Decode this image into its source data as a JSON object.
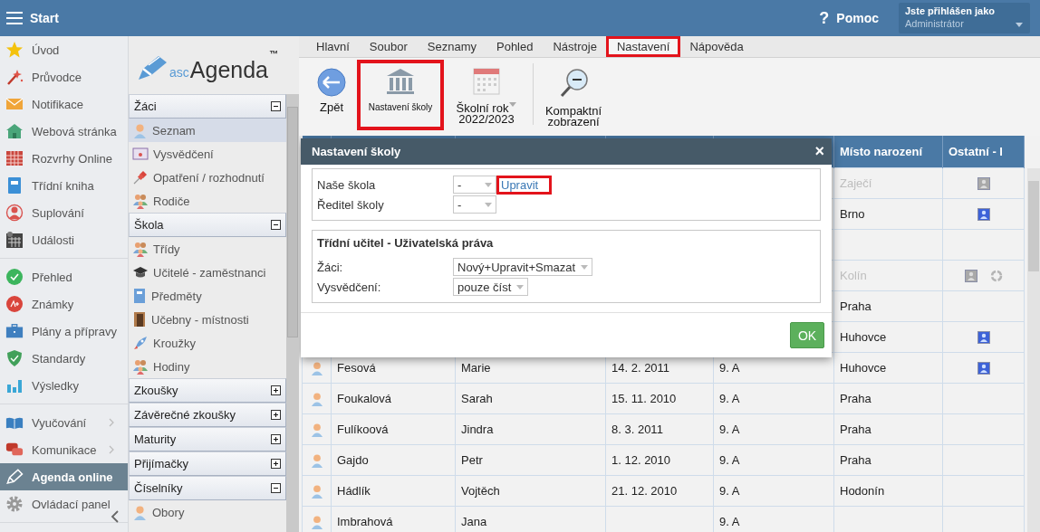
{
  "top_bar": {
    "title": "Start",
    "help_icon": "?",
    "help": "Pomoc",
    "user": {
      "caption": "Jste přihlášen jako",
      "role": "Administrátor"
    }
  },
  "nav": {
    "groups": [
      {
        "items": [
          {
            "label": "Úvod",
            "selected": false,
            "has_submenu": false
          },
          {
            "label": "Průvodce",
            "selected": false,
            "has_submenu": false
          },
          {
            "label": "Notifikace",
            "selected": false,
            "has_submenu": false
          },
          {
            "label": "Webová stránka",
            "selected": false,
            "has_submenu": false
          },
          {
            "label": "Rozvrhy Online",
            "selected": false,
            "has_submenu": false
          },
          {
            "label": "Třídní kniha",
            "selected": false,
            "has_submenu": false
          },
          {
            "label": "Suplování",
            "selected": false,
            "has_submenu": false
          },
          {
            "label": "Události",
            "selected": false,
            "has_submenu": false
          }
        ]
      },
      {
        "items": [
          {
            "label": "Přehled",
            "selected": false,
            "has_submenu": false
          },
          {
            "label": "Známky",
            "selected": false,
            "has_submenu": false
          },
          {
            "label": "Plány a přípravy",
            "selected": false,
            "has_submenu": false
          },
          {
            "label": "Standardy",
            "selected": false,
            "has_submenu": false
          },
          {
            "label": "Výsledky",
            "selected": false,
            "has_submenu": false
          }
        ]
      },
      {
        "items": [
          {
            "label": "Vyučování",
            "selected": false,
            "has_submenu": true
          },
          {
            "label": "Komunikace",
            "selected": false,
            "has_submenu": true
          },
          {
            "label": "Agenda online",
            "selected": true,
            "has_submenu": false
          },
          {
            "label": "Ovládací panel",
            "selected": false,
            "has_submenu": false
          }
        ]
      }
    ]
  },
  "agenda_sidebar": {
    "logo": {
      "prefix": "asc",
      "name": "Agenda",
      "mark": "™"
    },
    "sections": [
      {
        "title": "Žáci",
        "expanded": true,
        "items": [
          {
            "label": "Seznam",
            "selected": true
          },
          {
            "label": "Vysvědčení",
            "selected": false
          },
          {
            "label": "Opatření / rozhodnutí",
            "selected": false
          },
          {
            "label": "Rodiče",
            "selected": false
          }
        ]
      },
      {
        "title": "Škola",
        "expanded": true,
        "items": [
          {
            "label": "Třídy",
            "selected": false
          },
          {
            "label": "Učitelé - zaměstnanci",
            "selected": false
          },
          {
            "label": "Předměty",
            "selected": false
          },
          {
            "label": "Učebny - místnosti",
            "selected": false
          },
          {
            "label": "Kroužky",
            "selected": false
          },
          {
            "label": "Hodiny",
            "selected": false
          }
        ]
      },
      {
        "title": "Zkoušky",
        "expanded": false
      },
      {
        "title": "Závěrečné zkoušky",
        "expanded": false
      },
      {
        "title": "Maturity",
        "expanded": false
      },
      {
        "title": "Přijímačky",
        "expanded": false
      },
      {
        "title": "Číselníky",
        "expanded": true,
        "items": [
          {
            "label": "Obory",
            "selected": false
          }
        ]
      }
    ]
  },
  "menu": {
    "tabs": [
      {
        "label": "Hlavní",
        "selected": false,
        "highlighted": false
      },
      {
        "label": "Soubor",
        "selected": false,
        "highlighted": false
      },
      {
        "label": "Seznamy",
        "selected": false,
        "highlighted": false
      },
      {
        "label": "Pohled",
        "selected": false,
        "highlighted": false
      },
      {
        "label": "Nástroje",
        "selected": false,
        "highlighted": false
      },
      {
        "label": "Nastavení",
        "selected": true,
        "highlighted": true
      },
      {
        "label": "Nápověda",
        "selected": false,
        "highlighted": false
      }
    ]
  },
  "toolbar": {
    "buttons": [
      {
        "kind": "back",
        "label": "Zpět",
        "highlighted": false
      },
      {
        "kind": "school",
        "label": "Nastavení školy",
        "highlighted": true
      },
      {
        "kind": "year",
        "label": "Školní rok",
        "value": "2022/2023",
        "highlighted": false
      },
      {
        "kind": "compact",
        "label": "Kompaktní zobrazení",
        "highlighted": false
      }
    ]
  },
  "table": {
    "columns": [
      "Místo narození",
      "Ostatní - I"
    ],
    "rows": [
      {
        "birthplace": "Zaječí",
        "disabled": true,
        "account": true,
        "sync": false
      },
      {
        "birthplace": "Brno",
        "disabled": false,
        "account": true,
        "sync": false
      },
      {
        "disabled": false,
        "account": false,
        "sync": false
      },
      {
        "birthplace": "Kolín",
        "disabled": true,
        "account": true,
        "sync": true
      },
      {
        "birthplace": "Praha",
        "disabled": false,
        "account": false,
        "sync": false
      },
      {
        "birthplace": "Huhovce",
        "disabled": false,
        "account": true,
        "sync": false
      },
      {
        "surname": "Fesová",
        "first_name": "Marie",
        "birth_date": "14. 2. 2011",
        "class": "9. A",
        "birthplace": "Huhovce",
        "disabled": false,
        "account": true,
        "sync": false
      },
      {
        "surname": "Foukalová",
        "first_name": "Sarah",
        "birth_date": "15. 11. 2010",
        "class": "9. A",
        "birthplace": "Praha",
        "disabled": false,
        "account": false,
        "sync": false
      },
      {
        "surname": "Fulíkoová",
        "first_name": "Jindra",
        "birth_date": "8. 3. 2011",
        "class": "9. A",
        "birthplace": "Praha",
        "disabled": false,
        "account": false,
        "sync": false
      },
      {
        "surname": "Gajdo",
        "first_name": "Petr",
        "birth_date": "1. 12. 2010",
        "class": "9. A",
        "birthplace": "Praha",
        "disabled": false,
        "account": false,
        "sync": false
      },
      {
        "surname": "Hádlík",
        "first_name": "Vojtěch",
        "birth_date": "21. 12. 2010",
        "class": "9. A",
        "birthplace": "Hodonín",
        "disabled": false,
        "account": false,
        "sync": false
      },
      {
        "surname": "Imbrahová",
        "first_name": "Jana",
        "class": "9. A",
        "disabled": false,
        "account": false,
        "sync": false
      }
    ]
  },
  "dialog": {
    "title": "Nastavení školy",
    "close": "×",
    "school_fields": [
      {
        "label": "Naše škola",
        "value": "-",
        "link": "Upravit",
        "link_highlighted": true
      },
      {
        "label": "Ředitel školy",
        "value": "-"
      }
    ],
    "rights": {
      "title": "Třídní učitel - Uživatelská práva",
      "fields": [
        {
          "label": "Žáci:",
          "value": "Nový+Upravit+Smazat"
        },
        {
          "label": "Vysvědčení:",
          "value": "pouze číst"
        }
      ]
    },
    "ok": "OK"
  }
}
